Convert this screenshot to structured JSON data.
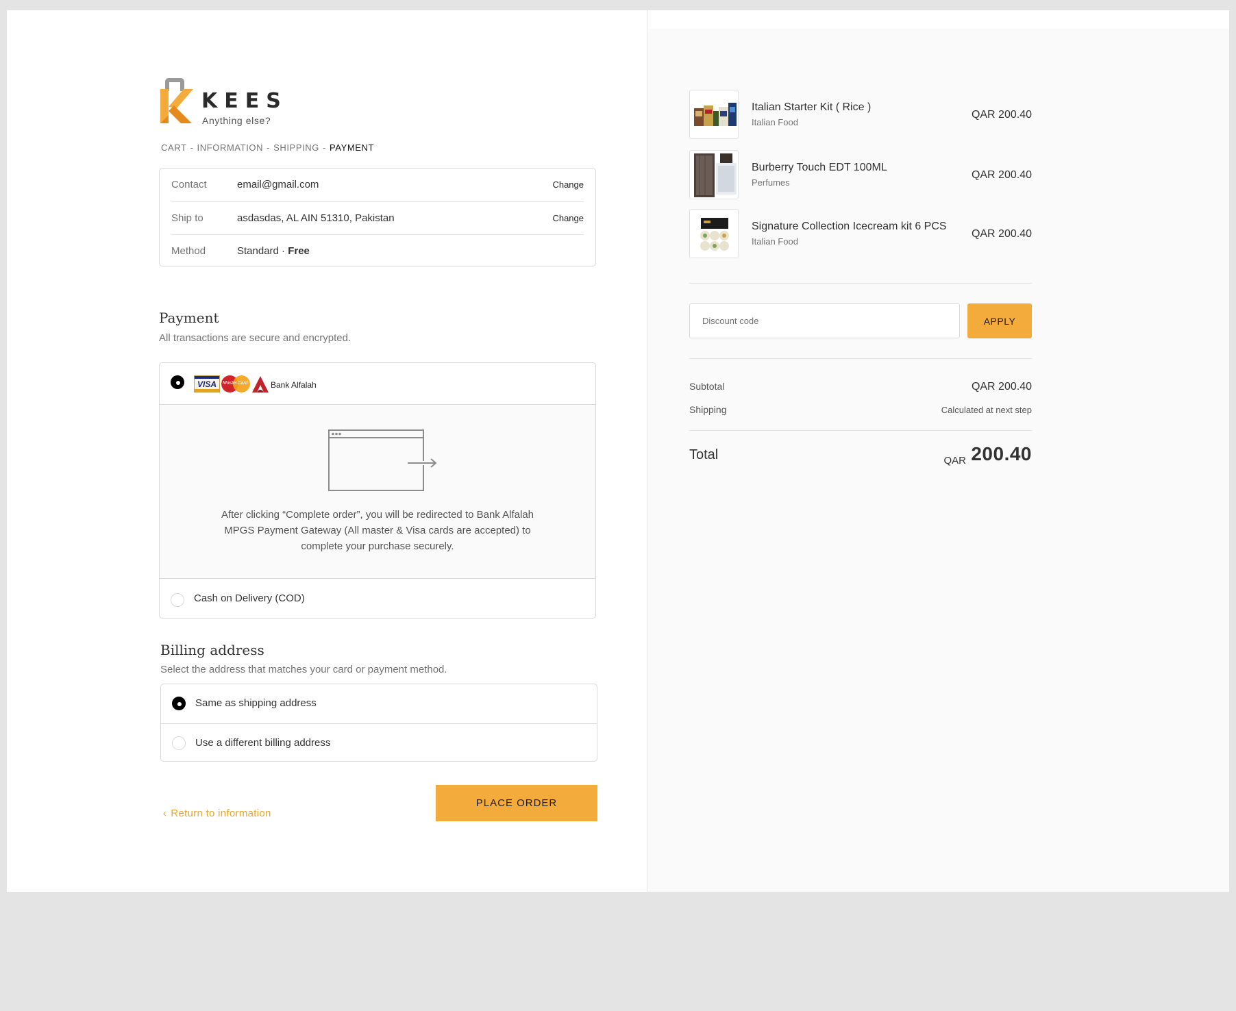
{
  "brand": {
    "name": "KEES",
    "tagline": "Anything else?",
    "accent_color": "#f3ac3b",
    "dark_color": "#2b2b2b"
  },
  "breadcrumb": {
    "items": [
      "CART",
      "INFORMATION",
      "SHIPPING",
      "PAYMENT"
    ],
    "separator": "-",
    "current_index": 3
  },
  "review": {
    "rows": [
      {
        "label": "Contact",
        "value": "email@gmail.com",
        "action": "Change"
      },
      {
        "label": "Ship to",
        "value": "asdasdas, AL AIN 51310, Pakistan",
        "action": "Change"
      },
      {
        "label": "Method",
        "value": "Standard · ",
        "value_bold": "Free"
      }
    ]
  },
  "payment": {
    "title": "Payment",
    "subtitle": "All transactions are secure and encrypted.",
    "options": [
      {
        "id": "bank-alfalah",
        "selected": true,
        "icons": [
          "visa-card-icon",
          "mastercard-icon",
          "bank-alfalah-logo-icon"
        ],
        "visa_text": "VISA",
        "mastercard_text": "MasterCard",
        "label": "Bank Alfalah",
        "redirect_icon": "browser-redirect-icon",
        "note": "After clicking “Complete order”, you will be redirected to Bank Alfalah MPGS Payment Gateway (All master & Visa cards are accepted) to complete your purchase securely."
      },
      {
        "id": "cod",
        "selected": false,
        "label": "Cash on Delivery (COD)"
      }
    ]
  },
  "billing": {
    "title": "Billing address",
    "subtitle": "Select the address that matches your card or payment method.",
    "options": [
      {
        "label": "Same as shipping address",
        "selected": true
      },
      {
        "label": "Use a different billing address",
        "selected": false
      }
    ]
  },
  "footer": {
    "return_label": "Return to information",
    "return_icon": "chevron-left-icon",
    "place_order_label": "PLACE ORDER"
  },
  "order": {
    "items": [
      {
        "name": "Italian Starter Kit ( Rice )",
        "category": "Italian Food",
        "price": "QAR 200.40"
      },
      {
        "name": "Burberry Touch EDT 100ML",
        "category": "Perfumes",
        "price": "QAR 200.40"
      },
      {
        "name": "Signature Collection Icecream kit 6 PCS",
        "category": "Italian Food",
        "price": "QAR 200.40"
      }
    ],
    "discount_placeholder": "Discount code",
    "apply_label": "APPLY",
    "subtotal_label": "Subtotal",
    "subtotal_value": "QAR 200.40",
    "shipping_label": "Shipping",
    "shipping_value": "Calculated at next step",
    "total_label": "Total",
    "total_currency": "QAR",
    "total_amount": "200.40"
  }
}
